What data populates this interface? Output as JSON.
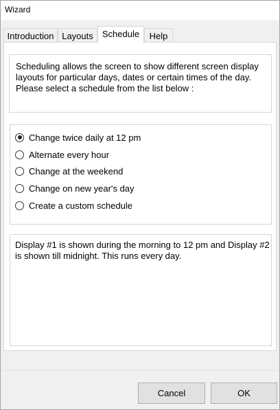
{
  "window": {
    "title": "Wizard"
  },
  "tabs": [
    {
      "label": "Introduction"
    },
    {
      "label": "Layouts"
    },
    {
      "label": "Schedule"
    },
    {
      "label": "Help"
    }
  ],
  "active_tab": "Schedule",
  "intro_text": "Scheduling allows the screen to show different screen display layouts for particular days, dates or certain times of the day. Please select a schedule from the list below :",
  "schedule_options": [
    {
      "label": "Change twice daily at 12 pm",
      "selected": true
    },
    {
      "label": "Alternate every hour",
      "selected": false
    },
    {
      "label": "Change at the weekend",
      "selected": false
    },
    {
      "label": "Change on new year's day",
      "selected": false
    },
    {
      "label": "Create a custom schedule",
      "selected": false
    }
  ],
  "description_text": "Display #1 is shown during the morning to 12 pm and Display #2 is shown till midnight. This runs every day.",
  "buttons": {
    "cancel": "Cancel",
    "ok": "OK"
  }
}
